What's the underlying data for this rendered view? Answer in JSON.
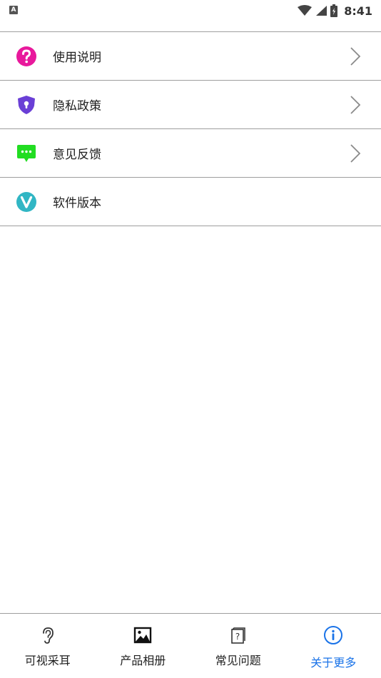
{
  "status_bar": {
    "left_icon_label": "A",
    "time": "8:41",
    "icons": [
      "wifi-icon",
      "signal-icon",
      "battery-icon"
    ]
  },
  "menu": {
    "items": [
      {
        "label": "使用说明",
        "icon": "help-question-icon",
        "icon_color": "#e8199c",
        "has_chevron": true
      },
      {
        "label": "隐私政策",
        "icon": "privacy-shield-icon",
        "icon_color": "#6a3fd6",
        "has_chevron": true
      },
      {
        "label": "意见反馈",
        "icon": "feedback-chat-icon",
        "icon_color": "#22dd22",
        "has_chevron": true
      },
      {
        "label": "软件版本",
        "icon": "version-v-icon",
        "icon_color": "#31b6c4",
        "has_chevron": false
      }
    ]
  },
  "tabs": [
    {
      "label": "可视采耳",
      "icon": "ear-icon",
      "active": false
    },
    {
      "label": "产品相册",
      "icon": "image-icon",
      "active": false
    },
    {
      "label": "常见问题",
      "icon": "faq-book-icon",
      "active": false
    },
    {
      "label": "关于更多",
      "icon": "info-circle-icon",
      "active": true
    }
  ],
  "colors": {
    "active_tab": "#1a73e8",
    "divider": "#9e9e9e",
    "text": "#1f1f1f"
  }
}
